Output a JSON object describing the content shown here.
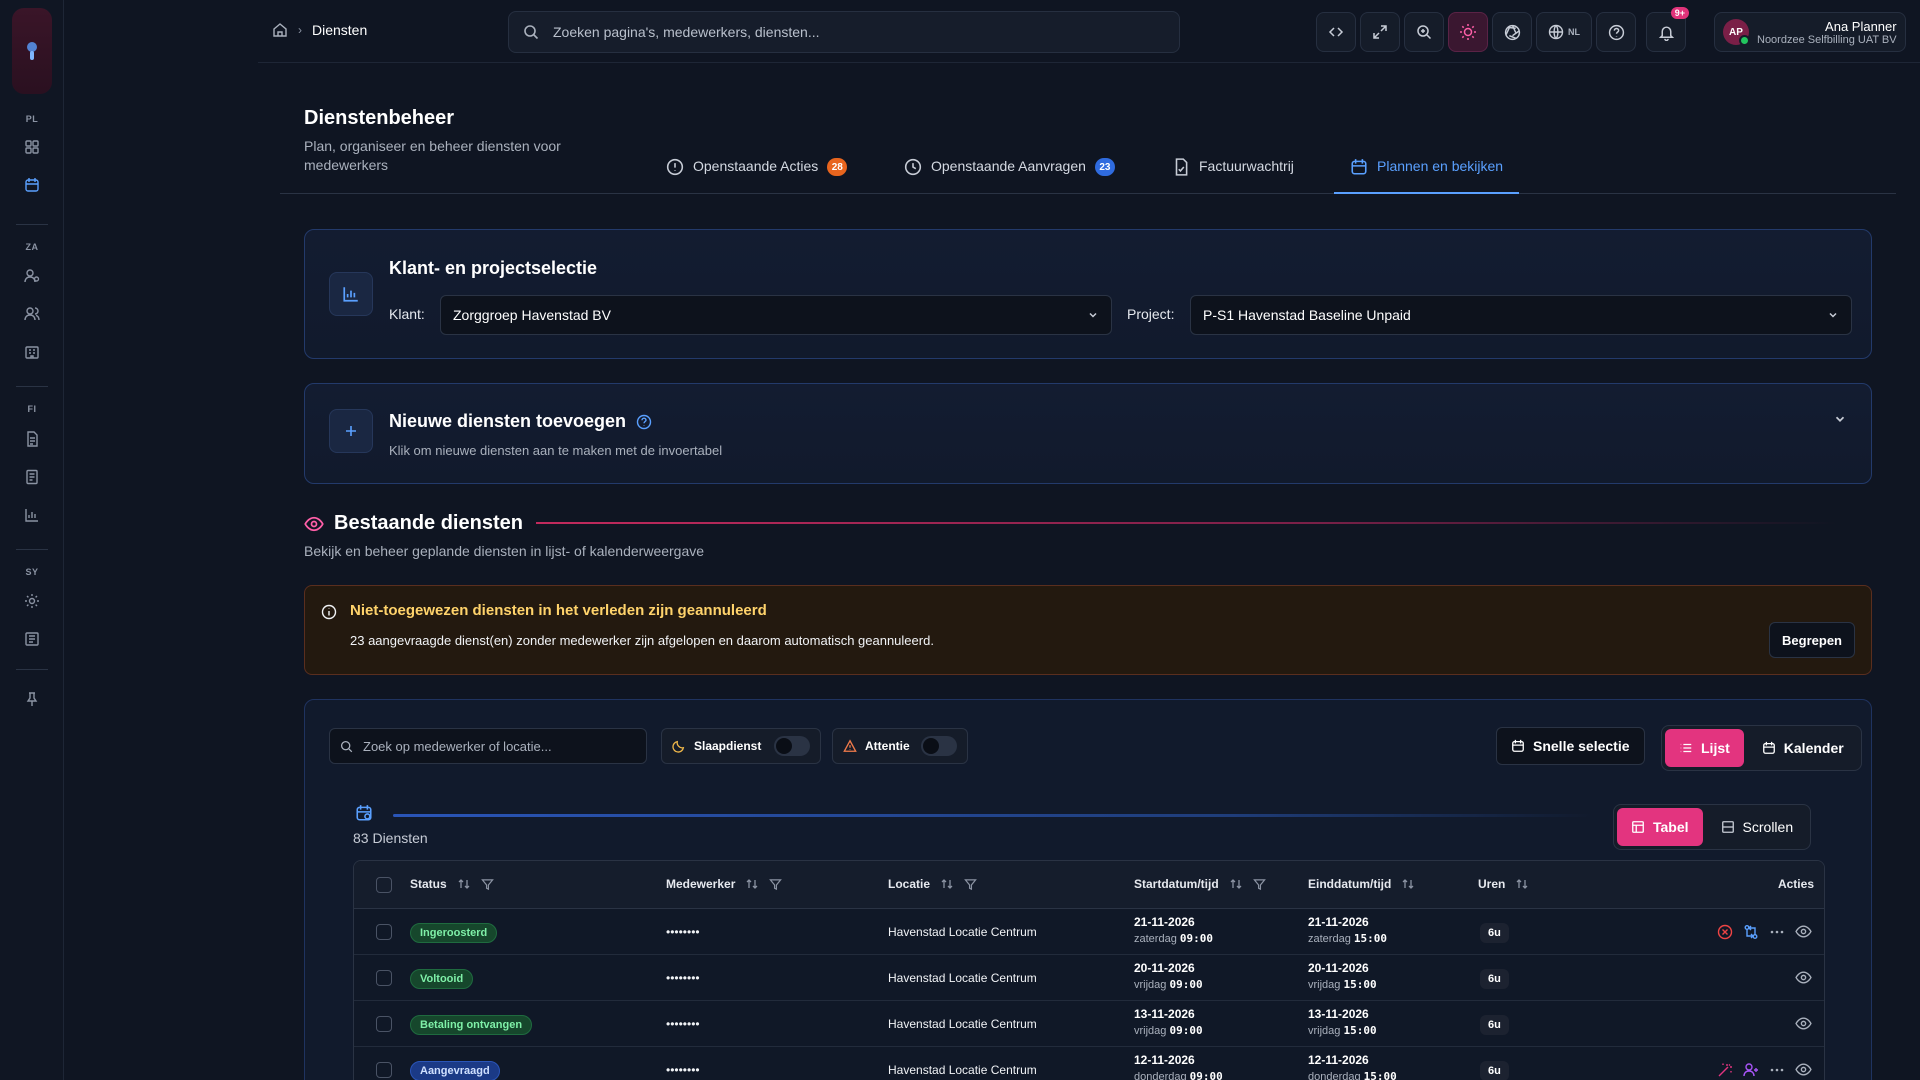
{
  "rail": {
    "sections": [
      "PL",
      "ZA",
      "FI",
      "SY"
    ]
  },
  "topbar": {
    "breadcrumb": "Diensten",
    "search_placeholder": "Zoeken pagina's, medewerkers, diensten...",
    "lang": "NL",
    "notif_badge": "9+",
    "user": {
      "initials": "AP",
      "name": "Ana Planner",
      "org": "Noordzee Selfbilling UAT BV"
    }
  },
  "header": {
    "title": "Dienstenbeheer",
    "subtitle": "Plan, organiseer en beheer diensten voor medewerkers"
  },
  "tabs": [
    {
      "label": "Openstaande Acties",
      "count": "28",
      "count_color": "#e8651e"
    },
    {
      "label": "Openstaande Aanvragen",
      "count": "23",
      "count_color": "#2f6bdf"
    },
    {
      "label": "Factuurwachtrij"
    },
    {
      "label": "Plannen en bekijken",
      "active": true
    }
  ],
  "selection": {
    "title": "Klant- en projectselectie",
    "klant_label": "Klant:",
    "klant_value": "Zorggroep Havenstad BV",
    "project_label": "Project:",
    "project_value": "P-S1 Havenstad Baseline Unpaid"
  },
  "new_services": {
    "title": "Nieuwe diensten toevoegen",
    "subtitle": "Klik om nieuwe diensten aan te maken met de invoertabel"
  },
  "existing": {
    "title": "Bestaande diensten",
    "subtitle": "Bekijk en beheer geplande diensten in lijst- of kalenderweergave"
  },
  "alert": {
    "title": "Niet-toegewezen diensten in het verleden zijn geannuleerd",
    "text": "23 aangevraagde dienst(en) zonder medewerker zijn afgelopen en daarom automatisch geannuleerd.",
    "button": "Begrepen"
  },
  "filters": {
    "search_placeholder": "Zoek op medewerker of locatie...",
    "sleep_label": "Slaapdienst",
    "attention_label": "Attentie",
    "quick_select": "Snelle selectie",
    "view_list": "Lijst",
    "view_calendar": "Kalender",
    "view_table": "Tabel",
    "view_scroll": "Scrollen",
    "count_label": "83 Diensten"
  },
  "table": {
    "headers": [
      "Status",
      "Medewerker",
      "Locatie",
      "Startdatum/tijd",
      "Einddatum/tijd",
      "Uren",
      "Acties"
    ],
    "rows": [
      {
        "status": "Ingeroosterd",
        "status_kind": "green",
        "employee": "••••••••",
        "location": "Havenstad Locatie Centrum",
        "start_date": "21-11-2026",
        "start_day": "zaterdag",
        "start_time": "09:00",
        "end_date": "21-11-2026",
        "end_day": "zaterdag",
        "end_time": "15:00",
        "hours": "6u",
        "actions": [
          "cancel",
          "swap",
          "more",
          "view"
        ]
      },
      {
        "status": "Voltooid",
        "status_kind": "green",
        "employee": "••••••••",
        "location": "Havenstad Locatie Centrum",
        "start_date": "20-11-2026",
        "start_day": "vrijdag",
        "start_time": "09:00",
        "end_date": "20-11-2026",
        "end_day": "vrijdag",
        "end_time": "15:00",
        "hours": "6u",
        "actions": [
          "view"
        ]
      },
      {
        "status": "Betaling ontvangen",
        "status_kind": "green",
        "employee": "••••••••",
        "location": "Havenstad Locatie Centrum",
        "start_date": "13-11-2026",
        "start_day": "vrijdag",
        "start_time": "09:00",
        "end_date": "13-11-2026",
        "end_day": "vrijdag",
        "end_time": "15:00",
        "hours": "6u",
        "actions": [
          "view"
        ]
      },
      {
        "status": "Aangevraagd",
        "status_kind": "blue",
        "employee": "••••••••",
        "location": "Havenstad Locatie Centrum",
        "start_date": "12-11-2026",
        "start_day": "donderdag",
        "start_time": "09:00",
        "end_date": "12-11-2026",
        "end_day": "donderdag",
        "end_time": "15:00",
        "hours": "6u",
        "actions": [
          "wand",
          "assign",
          "more",
          "view"
        ]
      }
    ]
  }
}
